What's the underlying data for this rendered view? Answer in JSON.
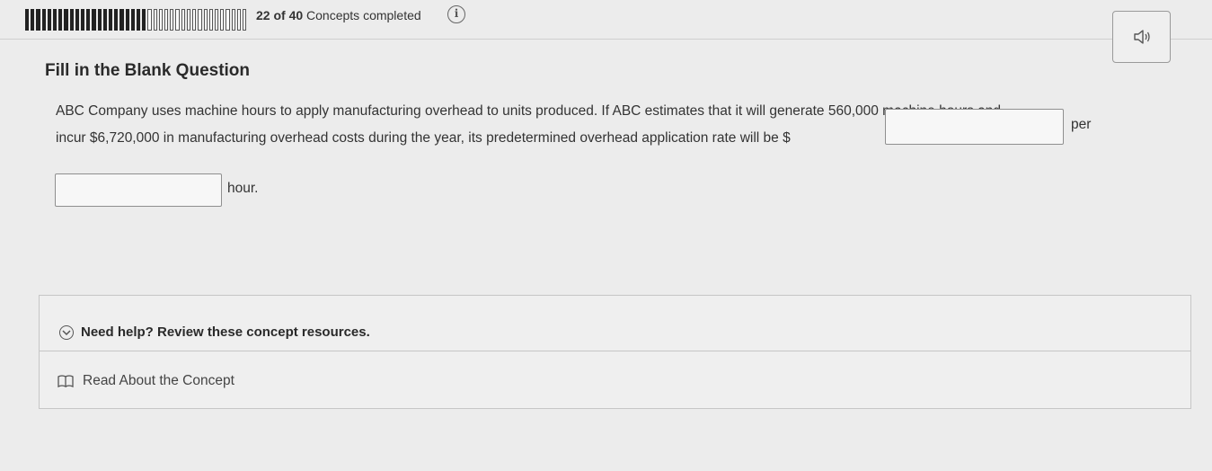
{
  "progress": {
    "completed": 22,
    "total": 40,
    "count_text": "22 of 40",
    "label": "Concepts completed"
  },
  "question": {
    "type_label": "Fill in the Blank Question",
    "line1": "ABC Company uses machine hours to apply manufacturing overhead to units produced. If ABC estimates that it will generate 560,000 machine hours and",
    "line2_prefix": "incur $6,720,000 in manufacturing overhead costs during the year, its predetermined overhead application rate will be $",
    "per_label": "per",
    "hour_label": "hour.",
    "blank1_value": "",
    "blank2_value": ""
  },
  "help": {
    "title": "Need help? Review these concept resources.",
    "read_link": "Read About the Concept"
  },
  "icons": {
    "info": "info-icon",
    "audio": "speaker-icon",
    "expand": "chevron-down-icon",
    "book": "book-icon"
  },
  "colors": {
    "segment_complete": "#222222",
    "segment_incomplete": "#ffffff",
    "background": "#ececec"
  }
}
